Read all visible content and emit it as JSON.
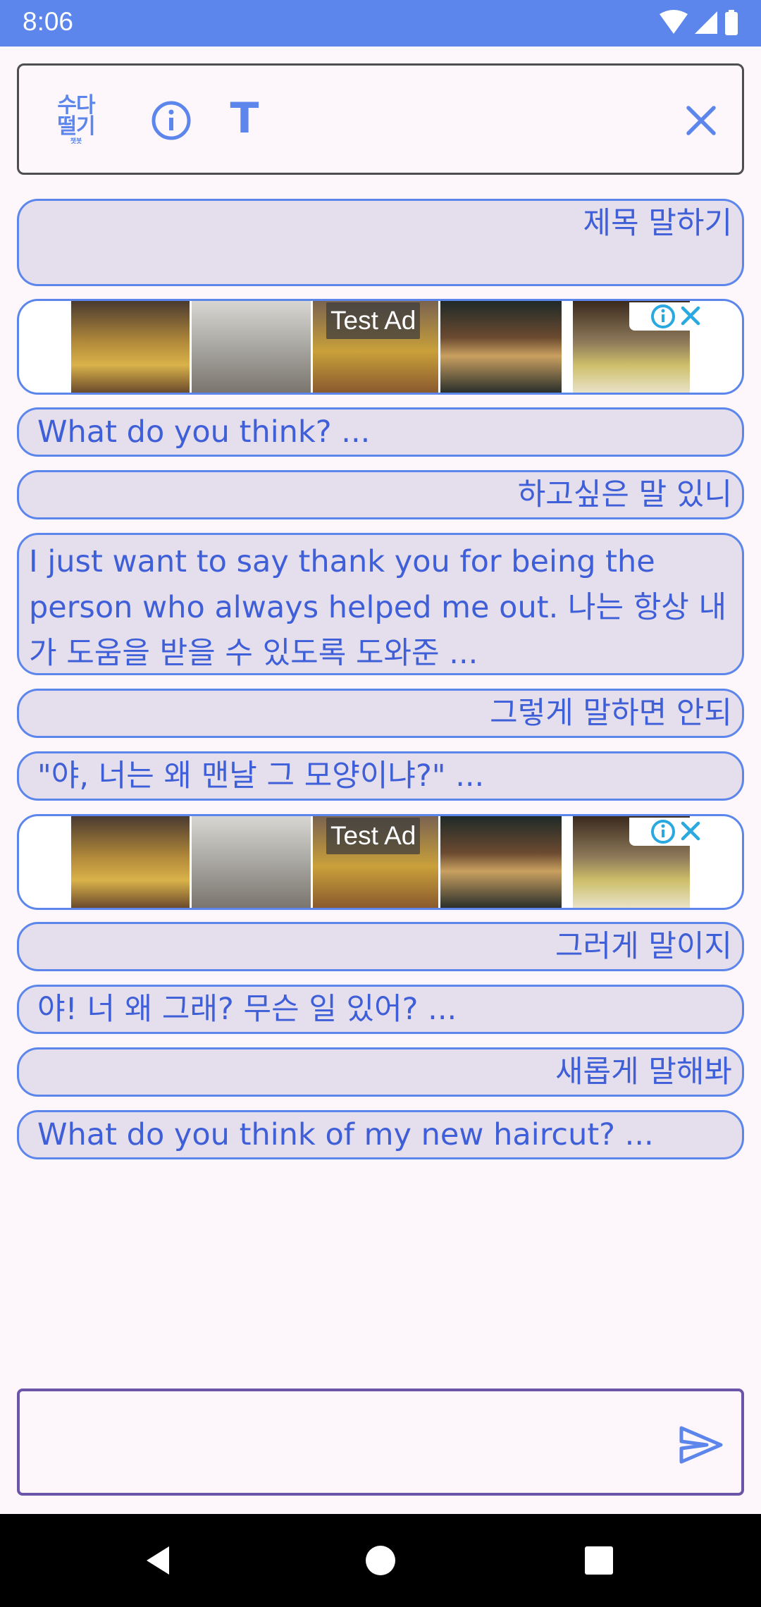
{
  "status_bar": {
    "time": "8:06",
    "icons": [
      "wifi-icon",
      "signal-icon",
      "battery-icon"
    ]
  },
  "toolbar": {
    "logo_line1": "수다",
    "logo_line2": "떨기",
    "logo_small": "챗봇",
    "info_icon": "info-icon",
    "font_label": "T",
    "close_icon": "close-icon"
  },
  "messages": [
    {
      "side": "right",
      "text": "제목 말하기"
    },
    {
      "side": "left",
      "text": "What do you think? ..."
    },
    {
      "side": "right",
      "text": "하고싶은 말 있니"
    },
    {
      "side": "left",
      "text": " I just want to say thank you for being the person who always helped me out. 나는 항상 내가 도움을 받을 수 있도록 도와준 ..."
    },
    {
      "side": "right",
      "text": "그렇게 말하면 안되"
    },
    {
      "side": "left",
      "text": "\"야, 너는 왜 맨날 그 모양이냐?\" ..."
    },
    {
      "side": "right",
      "text": "그러게 말이지"
    },
    {
      "side": "left",
      "text": "야! 너 왜 그래? 무슨 일 있어? ..."
    },
    {
      "side": "right",
      "text": "새롭게 말해봐"
    },
    {
      "side": "left",
      "text": "What do you think of my new haircut? ..."
    }
  ],
  "ads": [
    {
      "label": "Test Ad",
      "icons": [
        "adchoices-info-icon",
        "ad-close-icon"
      ]
    },
    {
      "label": "Test Ad",
      "icons": [
        "adchoices-info-icon",
        "ad-close-icon"
      ]
    }
  ],
  "composer": {
    "value": "",
    "placeholder": "",
    "send_icon": "send-icon"
  },
  "nav_bar": {
    "icons": [
      "back-icon",
      "home-icon",
      "recents-icon"
    ]
  },
  "colors": {
    "accent": "#5c86ec",
    "bubble_bg": "#e5deec",
    "bubble_text": "#3e5fd8",
    "input_border": "#6a55a8"
  }
}
